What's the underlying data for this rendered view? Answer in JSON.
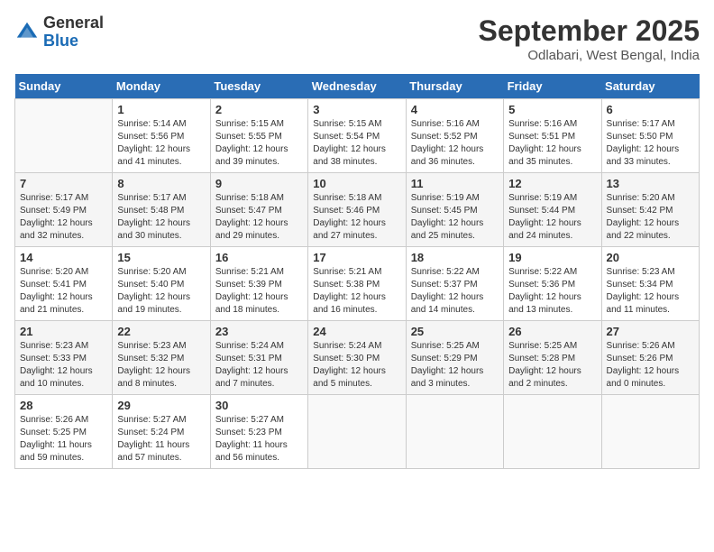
{
  "header": {
    "logo_general": "General",
    "logo_blue": "Blue",
    "month_title": "September 2025",
    "location": "Odlabari, West Bengal, India"
  },
  "days_of_week": [
    "Sunday",
    "Monday",
    "Tuesday",
    "Wednesday",
    "Thursday",
    "Friday",
    "Saturday"
  ],
  "weeks": [
    [
      {
        "day": "",
        "info": ""
      },
      {
        "day": "1",
        "info": "Sunrise: 5:14 AM\nSunset: 5:56 PM\nDaylight: 12 hours\nand 41 minutes."
      },
      {
        "day": "2",
        "info": "Sunrise: 5:15 AM\nSunset: 5:55 PM\nDaylight: 12 hours\nand 39 minutes."
      },
      {
        "day": "3",
        "info": "Sunrise: 5:15 AM\nSunset: 5:54 PM\nDaylight: 12 hours\nand 38 minutes."
      },
      {
        "day": "4",
        "info": "Sunrise: 5:16 AM\nSunset: 5:52 PM\nDaylight: 12 hours\nand 36 minutes."
      },
      {
        "day": "5",
        "info": "Sunrise: 5:16 AM\nSunset: 5:51 PM\nDaylight: 12 hours\nand 35 minutes."
      },
      {
        "day": "6",
        "info": "Sunrise: 5:17 AM\nSunset: 5:50 PM\nDaylight: 12 hours\nand 33 minutes."
      }
    ],
    [
      {
        "day": "7",
        "info": "Sunrise: 5:17 AM\nSunset: 5:49 PM\nDaylight: 12 hours\nand 32 minutes."
      },
      {
        "day": "8",
        "info": "Sunrise: 5:17 AM\nSunset: 5:48 PM\nDaylight: 12 hours\nand 30 minutes."
      },
      {
        "day": "9",
        "info": "Sunrise: 5:18 AM\nSunset: 5:47 PM\nDaylight: 12 hours\nand 29 minutes."
      },
      {
        "day": "10",
        "info": "Sunrise: 5:18 AM\nSunset: 5:46 PM\nDaylight: 12 hours\nand 27 minutes."
      },
      {
        "day": "11",
        "info": "Sunrise: 5:19 AM\nSunset: 5:45 PM\nDaylight: 12 hours\nand 25 minutes."
      },
      {
        "day": "12",
        "info": "Sunrise: 5:19 AM\nSunset: 5:44 PM\nDaylight: 12 hours\nand 24 minutes."
      },
      {
        "day": "13",
        "info": "Sunrise: 5:20 AM\nSunset: 5:42 PM\nDaylight: 12 hours\nand 22 minutes."
      }
    ],
    [
      {
        "day": "14",
        "info": "Sunrise: 5:20 AM\nSunset: 5:41 PM\nDaylight: 12 hours\nand 21 minutes."
      },
      {
        "day": "15",
        "info": "Sunrise: 5:20 AM\nSunset: 5:40 PM\nDaylight: 12 hours\nand 19 minutes."
      },
      {
        "day": "16",
        "info": "Sunrise: 5:21 AM\nSunset: 5:39 PM\nDaylight: 12 hours\nand 18 minutes."
      },
      {
        "day": "17",
        "info": "Sunrise: 5:21 AM\nSunset: 5:38 PM\nDaylight: 12 hours\nand 16 minutes."
      },
      {
        "day": "18",
        "info": "Sunrise: 5:22 AM\nSunset: 5:37 PM\nDaylight: 12 hours\nand 14 minutes."
      },
      {
        "day": "19",
        "info": "Sunrise: 5:22 AM\nSunset: 5:36 PM\nDaylight: 12 hours\nand 13 minutes."
      },
      {
        "day": "20",
        "info": "Sunrise: 5:23 AM\nSunset: 5:34 PM\nDaylight: 12 hours\nand 11 minutes."
      }
    ],
    [
      {
        "day": "21",
        "info": "Sunrise: 5:23 AM\nSunset: 5:33 PM\nDaylight: 12 hours\nand 10 minutes."
      },
      {
        "day": "22",
        "info": "Sunrise: 5:23 AM\nSunset: 5:32 PM\nDaylight: 12 hours\nand 8 minutes."
      },
      {
        "day": "23",
        "info": "Sunrise: 5:24 AM\nSunset: 5:31 PM\nDaylight: 12 hours\nand 7 minutes."
      },
      {
        "day": "24",
        "info": "Sunrise: 5:24 AM\nSunset: 5:30 PM\nDaylight: 12 hours\nand 5 minutes."
      },
      {
        "day": "25",
        "info": "Sunrise: 5:25 AM\nSunset: 5:29 PM\nDaylight: 12 hours\nand 3 minutes."
      },
      {
        "day": "26",
        "info": "Sunrise: 5:25 AM\nSunset: 5:28 PM\nDaylight: 12 hours\nand 2 minutes."
      },
      {
        "day": "27",
        "info": "Sunrise: 5:26 AM\nSunset: 5:26 PM\nDaylight: 12 hours\nand 0 minutes."
      }
    ],
    [
      {
        "day": "28",
        "info": "Sunrise: 5:26 AM\nSunset: 5:25 PM\nDaylight: 11 hours\nand 59 minutes."
      },
      {
        "day": "29",
        "info": "Sunrise: 5:27 AM\nSunset: 5:24 PM\nDaylight: 11 hours\nand 57 minutes."
      },
      {
        "day": "30",
        "info": "Sunrise: 5:27 AM\nSunset: 5:23 PM\nDaylight: 11 hours\nand 56 minutes."
      },
      {
        "day": "",
        "info": ""
      },
      {
        "day": "",
        "info": ""
      },
      {
        "day": "",
        "info": ""
      },
      {
        "day": "",
        "info": ""
      }
    ]
  ]
}
